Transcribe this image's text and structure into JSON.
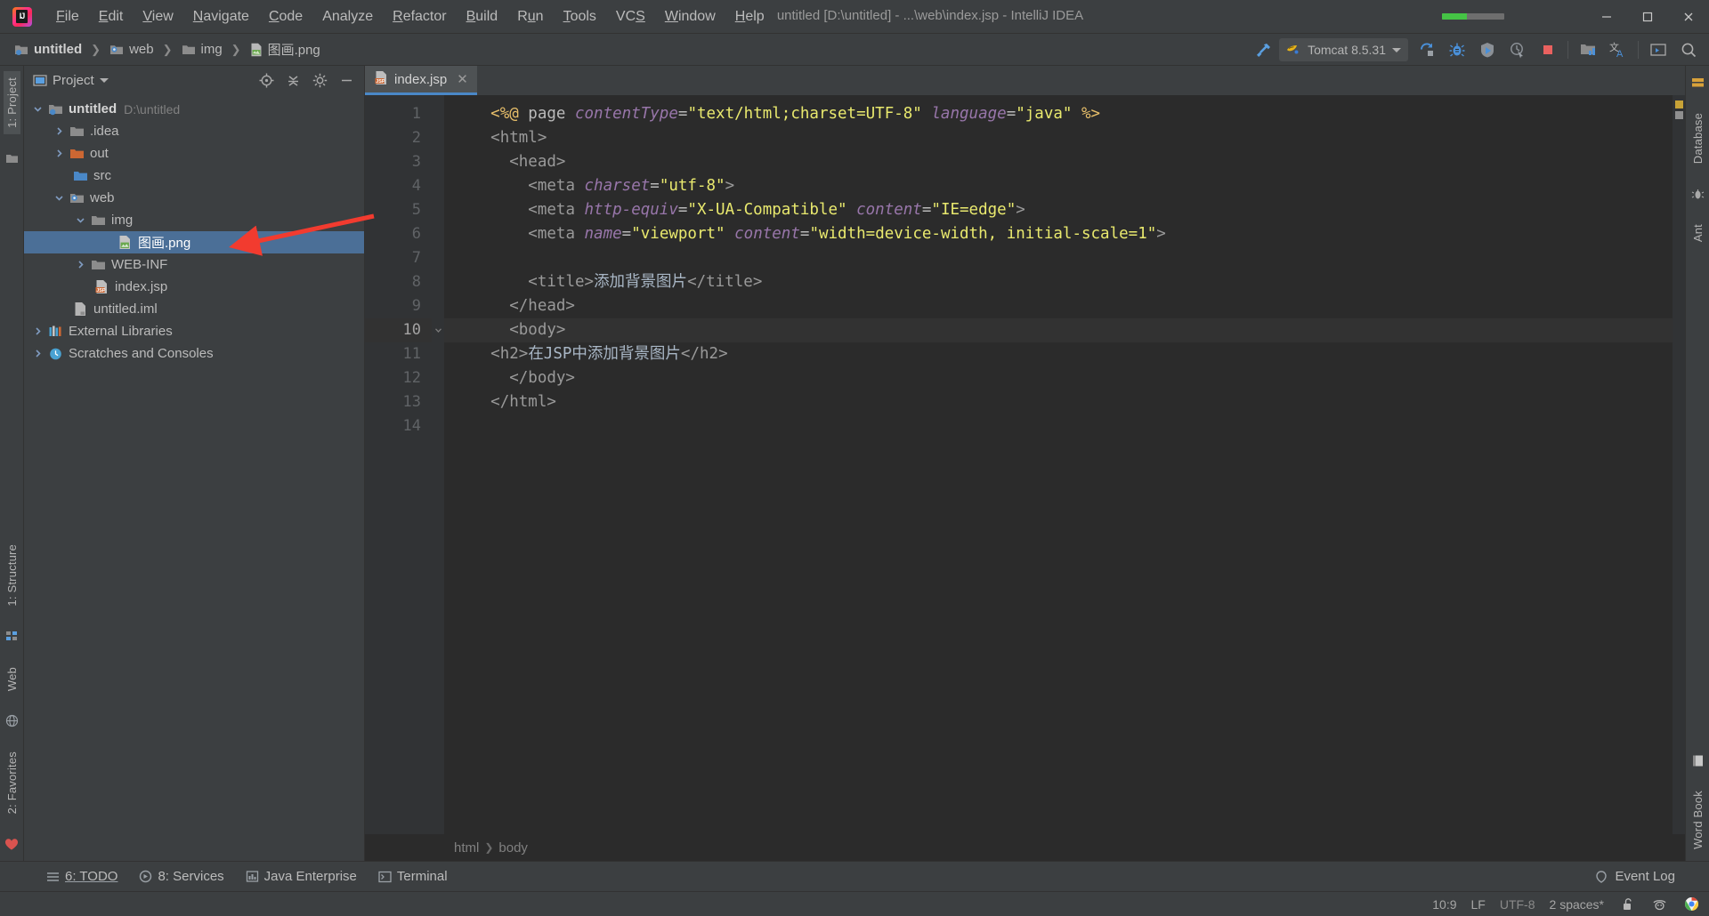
{
  "window": {
    "title": "untitled [D:\\untitled] - ...\\web\\index.jsp - IntelliJ IDEA",
    "minimize": "—",
    "maximize": "▢",
    "close": "✕"
  },
  "menu": {
    "items": [
      {
        "label": "File",
        "mnemonic": "F"
      },
      {
        "label": "Edit",
        "mnemonic": "E"
      },
      {
        "label": "View",
        "mnemonic": "V"
      },
      {
        "label": "Navigate",
        "mnemonic": "N"
      },
      {
        "label": "Code",
        "mnemonic": "C"
      },
      {
        "label": "Analyze",
        "mnemonic": "A"
      },
      {
        "label": "Refactor",
        "mnemonic": "R"
      },
      {
        "label": "Build",
        "mnemonic": "B"
      },
      {
        "label": "Run",
        "mnemonic": "u"
      },
      {
        "label": "Tools",
        "mnemonic": "T"
      },
      {
        "label": "VCS",
        "mnemonic": "S"
      },
      {
        "label": "Window",
        "mnemonic": "W"
      },
      {
        "label": "Help",
        "mnemonic": "H"
      }
    ]
  },
  "breadcrumbs": [
    {
      "label": "untitled",
      "icon": "module-folder-icon"
    },
    {
      "label": "web",
      "icon": "web-folder-icon"
    },
    {
      "label": "img",
      "icon": "folder-icon"
    },
    {
      "label": "图画.png",
      "icon": "image-file-icon"
    }
  ],
  "toolbar": {
    "build_label": "Build",
    "run_config": "Tomcat 8.5.31",
    "run_label": "Run",
    "debug_label": "Debug",
    "run_coverage_label": "Run with Coverage",
    "profile_label": "Profile",
    "stop_label": "Stop",
    "project_structure_label": "Project Structure",
    "translate_label": "Translate",
    "terminal_label": "Terminal",
    "search_label": "Search Everywhere"
  },
  "left_rail": {
    "top": [
      {
        "label": "1: Project"
      }
    ],
    "bottom": [
      {
        "label": "1: Structure"
      },
      {
        "label": "Web"
      },
      {
        "label": "2: Favorites"
      }
    ]
  },
  "right_rail": {
    "top": [
      {
        "label": "Database"
      },
      {
        "label": "Ant"
      }
    ],
    "bottom": [
      {
        "label": "Word Book"
      }
    ]
  },
  "project_panel": {
    "title": "Project",
    "locate_label": "Select Opened File",
    "collapse_label": "Collapse All",
    "settings_label": "Settings",
    "hide_label": "Hide",
    "tree": [
      {
        "label": "untitled",
        "sub": "D:\\untitled",
        "indent": 0,
        "arrow": "down",
        "icon": "module-folder-icon",
        "bold": true,
        "selected": false
      },
      {
        "label": ".idea",
        "sub": "",
        "indent": 1,
        "arrow": "right",
        "icon": "folder-icon",
        "bold": false,
        "selected": false
      },
      {
        "label": "out",
        "sub": "",
        "indent": 1,
        "arrow": "right",
        "icon": "folder-orange-icon",
        "bold": false,
        "selected": false
      },
      {
        "label": "src",
        "sub": "",
        "indent": 1,
        "arrow": "none",
        "icon": "folder-blue-icon",
        "bold": false,
        "selected": false
      },
      {
        "label": "web",
        "sub": "",
        "indent": 1,
        "arrow": "down",
        "icon": "web-folder-icon",
        "bold": false,
        "selected": false
      },
      {
        "label": "img",
        "sub": "",
        "indent": 2,
        "arrow": "down",
        "icon": "folder-icon",
        "bold": false,
        "selected": false
      },
      {
        "label": "图画.png",
        "sub": "",
        "indent": 3,
        "arrow": "none",
        "icon": "image-file-icon",
        "bold": false,
        "selected": true
      },
      {
        "label": "WEB-INF",
        "sub": "",
        "indent": 2,
        "arrow": "right",
        "icon": "folder-icon",
        "bold": false,
        "selected": false
      },
      {
        "label": "index.jsp",
        "sub": "",
        "indent": 2,
        "arrow": "none",
        "icon": "jsp-file-icon",
        "bold": false,
        "selected": false
      },
      {
        "label": "untitled.iml",
        "sub": "",
        "indent": 1,
        "arrow": "none",
        "icon": "iml-file-icon",
        "bold": false,
        "selected": false
      },
      {
        "label": "External Libraries",
        "sub": "",
        "indent": 0,
        "arrow": "right",
        "icon": "libraries-icon",
        "bold": false,
        "selected": false
      },
      {
        "label": "Scratches and Consoles",
        "sub": "",
        "indent": 0,
        "arrow": "right",
        "icon": "scratches-icon",
        "bold": false,
        "selected": false
      }
    ]
  },
  "editor": {
    "tab": {
      "label": "index.jsp",
      "icon": "jsp-file-icon",
      "close": "✕"
    },
    "lines": [
      {
        "n": "1",
        "current": false,
        "tokens": [
          {
            "t": "    ",
            "c": "k-plain"
          },
          {
            "t": "<%@",
            "c": "k-dir"
          },
          {
            "t": " page ",
            "c": "k-plain"
          },
          {
            "t": "contentType",
            "c": "k-attrn"
          },
          {
            "t": "=",
            "c": "k-plain"
          },
          {
            "t": "\"text/html;charset=UTF-8\"",
            "c": "k-val"
          },
          {
            "t": " ",
            "c": "k-plain"
          },
          {
            "t": "language",
            "c": "k-attrn"
          },
          {
            "t": "=",
            "c": "k-plain"
          },
          {
            "t": "\"java\"",
            "c": "k-val"
          },
          {
            "t": " ",
            "c": "k-plain"
          },
          {
            "t": "%>",
            "c": "k-dir"
          }
        ]
      },
      {
        "n": "2",
        "current": false,
        "tokens": [
          {
            "t": "    ",
            "c": "k-plain"
          },
          {
            "t": "<html>",
            "c": "k-taggrey"
          }
        ]
      },
      {
        "n": "3",
        "current": false,
        "tokens": [
          {
            "t": "      ",
            "c": "k-plain"
          },
          {
            "t": "<head>",
            "c": "k-taggrey"
          }
        ]
      },
      {
        "n": "4",
        "current": false,
        "tokens": [
          {
            "t": "        ",
            "c": "k-plain"
          },
          {
            "t": "<meta ",
            "c": "k-taggrey"
          },
          {
            "t": "charset",
            "c": "k-attrn"
          },
          {
            "t": "=",
            "c": "k-plain"
          },
          {
            "t": "\"utf-8\"",
            "c": "k-val"
          },
          {
            "t": ">",
            "c": "k-taggrey"
          }
        ]
      },
      {
        "n": "5",
        "current": false,
        "tokens": [
          {
            "t": "        ",
            "c": "k-plain"
          },
          {
            "t": "<meta ",
            "c": "k-taggrey"
          },
          {
            "t": "http-equiv",
            "c": "k-attrn"
          },
          {
            "t": "=",
            "c": "k-plain"
          },
          {
            "t": "\"X-UA-Compatible\"",
            "c": "k-val"
          },
          {
            "t": " ",
            "c": "k-plain"
          },
          {
            "t": "content",
            "c": "k-attrn"
          },
          {
            "t": "=",
            "c": "k-plain"
          },
          {
            "t": "\"IE=edge\"",
            "c": "k-val"
          },
          {
            "t": ">",
            "c": "k-taggrey"
          }
        ]
      },
      {
        "n": "6",
        "current": false,
        "tokens": [
          {
            "t": "        ",
            "c": "k-plain"
          },
          {
            "t": "<meta ",
            "c": "k-taggrey"
          },
          {
            "t": "name",
            "c": "k-attrn"
          },
          {
            "t": "=",
            "c": "k-plain"
          },
          {
            "t": "\"viewport\"",
            "c": "k-val"
          },
          {
            "t": " ",
            "c": "k-plain"
          },
          {
            "t": "content",
            "c": "k-attrn"
          },
          {
            "t": "=",
            "c": "k-plain"
          },
          {
            "t": "\"width=device-width, initial-scale=1\"",
            "c": "k-val"
          },
          {
            "t": ">",
            "c": "k-taggrey"
          }
        ]
      },
      {
        "n": "7",
        "current": false,
        "tokens": []
      },
      {
        "n": "8",
        "current": false,
        "tokens": [
          {
            "t": "        ",
            "c": "k-plain"
          },
          {
            "t": "<title>",
            "c": "k-taggrey"
          },
          {
            "t": "添加背景图片",
            "c": "k-txt"
          },
          {
            "t": "</title>",
            "c": "k-taggrey"
          }
        ]
      },
      {
        "n": "9",
        "current": false,
        "tokens": [
          {
            "t": "      ",
            "c": "k-plain"
          },
          {
            "t": "</head>",
            "c": "k-taggrey"
          }
        ]
      },
      {
        "n": "10",
        "current": true,
        "tokens": [
          {
            "t": "      ",
            "c": "k-plain"
          },
          {
            "t": "<body>",
            "c": "k-taggrey"
          }
        ]
      },
      {
        "n": "11",
        "current": false,
        "tokens": [
          {
            "t": "    ",
            "c": "k-plain"
          },
          {
            "t": "<h2>",
            "c": "k-taggrey"
          },
          {
            "t": "在JSP中添加背景图片",
            "c": "k-txt"
          },
          {
            "t": "</h2>",
            "c": "k-taggrey"
          }
        ]
      },
      {
        "n": "12",
        "current": false,
        "tokens": [
          {
            "t": "      ",
            "c": "k-plain"
          },
          {
            "t": "</body>",
            "c": "k-taggrey"
          }
        ]
      },
      {
        "n": "13",
        "current": false,
        "tokens": [
          {
            "t": "    ",
            "c": "k-plain"
          },
          {
            "t": "</html>",
            "c": "k-taggrey"
          }
        ]
      },
      {
        "n": "14",
        "current": false,
        "tokens": []
      }
    ],
    "breadcrumb": [
      {
        "label": "html"
      },
      {
        "label": "body"
      }
    ]
  },
  "bottom_bar": {
    "items": [
      {
        "label": "6: TODO",
        "mnemonic": "6",
        "icon": "todo-icon"
      },
      {
        "label": "8: Services",
        "mnemonic": "8",
        "icon": "services-icon"
      },
      {
        "label": "Java Enterprise",
        "mnemonic": "",
        "icon": "java-enterprise-icon"
      },
      {
        "label": "Terminal",
        "mnemonic": "",
        "icon": "terminal-icon"
      }
    ],
    "event_log": "Event Log"
  },
  "status_bar": {
    "caret": "10:9",
    "line_separator": "LF",
    "encoding": "UTF-8",
    "indent": "2 spaces*",
    "lock": "unlocked-icon",
    "inspector": "hector-icon",
    "browser": "chrome-icon"
  },
  "colors": {
    "accent_blue": "#4a88c7",
    "selection_blue": "#4b6f97",
    "annotation_red": "#f23b2f",
    "editor_bg": "#2b2b2b",
    "panel_bg": "#3c3f41",
    "string_green": "#a5c261",
    "attr_yellow": "#e9e96e",
    "attrname_purple": "#9876aa"
  }
}
